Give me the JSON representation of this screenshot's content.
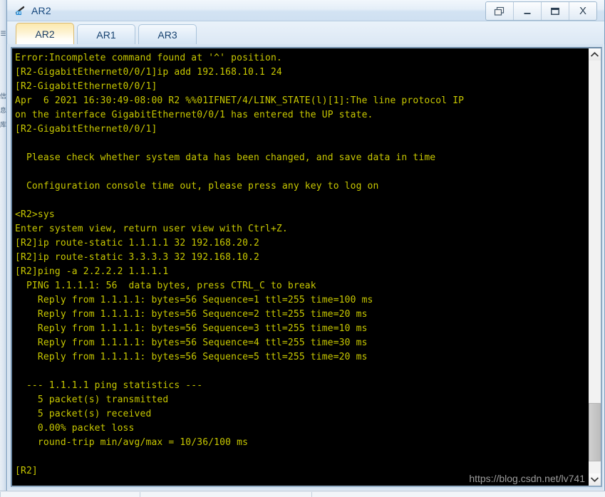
{
  "window": {
    "title": "AR2",
    "icon": "router-icon",
    "controls": [
      {
        "name": "restore-button",
        "glyph": "restore-icon",
        "label": "Restore"
      },
      {
        "name": "minimize-button",
        "glyph": "minimize-icon",
        "label": "Minimize"
      },
      {
        "name": "maximize-button",
        "glyph": "maximize-icon",
        "label": "Maximize"
      },
      {
        "name": "close-button",
        "glyph": "close-icon",
        "label": "X"
      }
    ]
  },
  "tabs": [
    {
      "label": "AR2",
      "active": true
    },
    {
      "label": "AR1",
      "active": false
    },
    {
      "label": "AR3",
      "active": false
    }
  ],
  "console": {
    "foreground_color": "#c8c800",
    "background_color": "#000000",
    "lines": [
      "Error:Incomplete command found at '^' position.",
      "[R2-GigabitEthernet0/0/1]ip add 192.168.10.1 24",
      "[R2-GigabitEthernet0/0/1]",
      "Apr  6 2021 16:30:49-08:00 R2 %%01IFNET/4/LINK_STATE(l)[1]:The line protocol IP",
      "on the interface GigabitEthernet0/0/1 has entered the UP state.",
      "[R2-GigabitEthernet0/0/1]",
      "",
      "  Please check whether system data has been changed, and save data in time",
      "",
      "  Configuration console time out, please press any key to log on",
      "",
      "<R2>sys",
      "Enter system view, return user view with Ctrl+Z.",
      "[R2]ip route-static 1.1.1.1 32 192.168.20.2",
      "[R2]ip route-static 3.3.3.3 32 192.168.10.2",
      "[R2]ping -a 2.2.2.2 1.1.1.1",
      "  PING 1.1.1.1: 56  data bytes, press CTRL_C to break",
      "    Reply from 1.1.1.1: bytes=56 Sequence=1 ttl=255 time=100 ms",
      "    Reply from 1.1.1.1: bytes=56 Sequence=2 ttl=255 time=20 ms",
      "    Reply from 1.1.1.1: bytes=56 Sequence=3 ttl=255 time=10 ms",
      "    Reply from 1.1.1.1: bytes=56 Sequence=4 ttl=255 time=30 ms",
      "    Reply from 1.1.1.1: bytes=56 Sequence=5 ttl=255 time=20 ms",
      "",
      "  --- 1.1.1.1 ping statistics ---",
      "    5 packet(s) transmitted",
      "    5 packet(s) received",
      "    0.00% packet loss",
      "    round-trip min/avg/max = 10/36/100 ms",
      "",
      "[R2]"
    ],
    "watermark": "https://blog.csdn.net/lv741"
  },
  "scrollbar": {
    "up_arrow": "chevron-up-icon",
    "down_arrow": "chevron-down-icon",
    "thumb_top_percent": 83,
    "thumb_height_percent": 14
  },
  "background": {
    "left_strip_glyphs": [
      "☰",
      "信",
      "息",
      "库"
    ],
    "edge_marker_color": "#5ec95e"
  }
}
